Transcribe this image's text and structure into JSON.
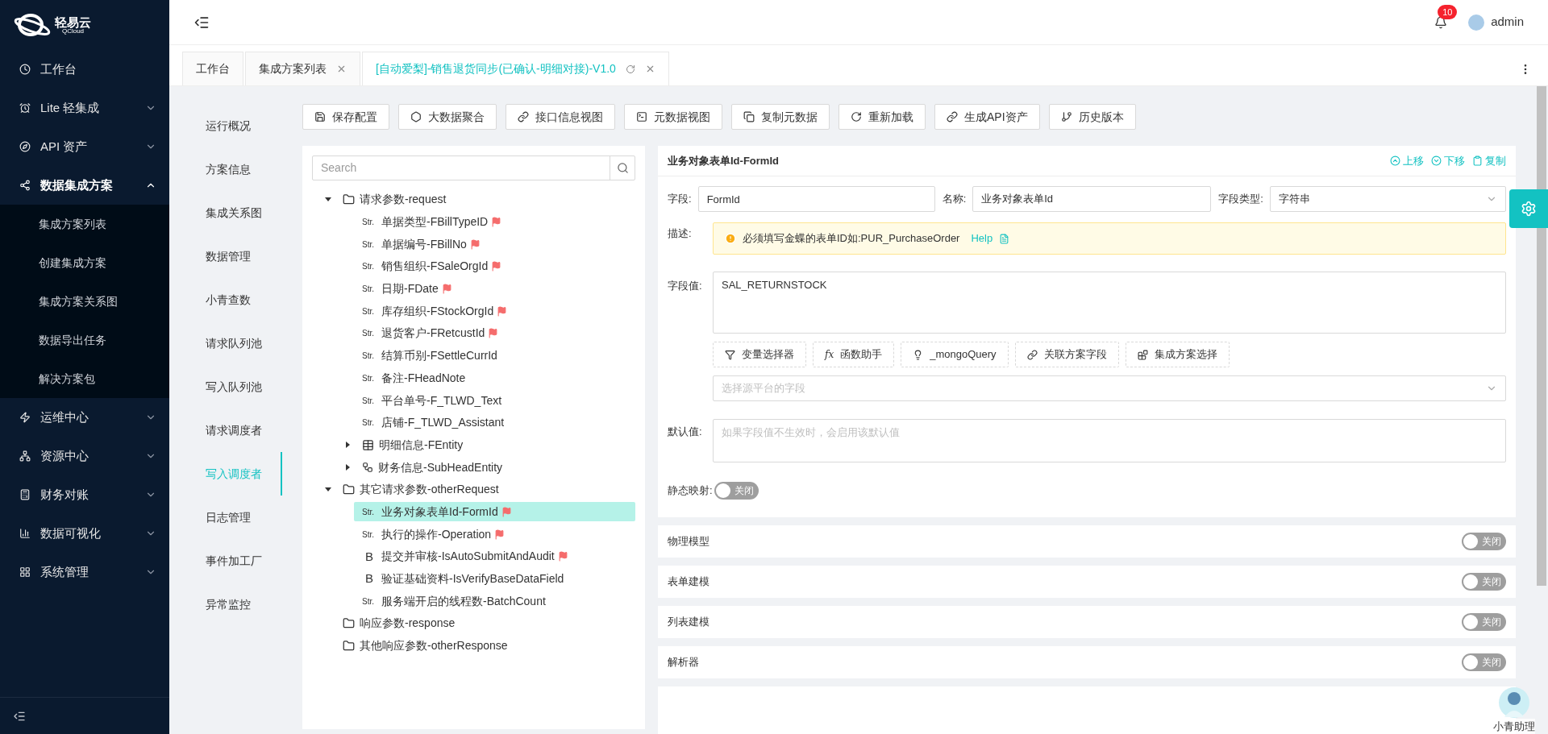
{
  "sidebar": {
    "logo": {
      "name": "轻易云",
      "sub": "QCloud"
    },
    "items": [
      {
        "label": "工作台",
        "kind": "clock"
      },
      {
        "label": "Lite 轻集成",
        "kind": "alarm",
        "expanded": false
      },
      {
        "label": "API 资产",
        "kind": "compass",
        "expanded": false
      },
      {
        "label": "数据集成方案",
        "kind": "graph",
        "expanded": true,
        "children": [
          {
            "label": "集成方案列表"
          },
          {
            "label": "创建集成方案"
          },
          {
            "label": "集成方案关系图"
          },
          {
            "label": "数据导出任务"
          },
          {
            "label": "解决方案包"
          }
        ]
      },
      {
        "label": "运维中心",
        "kind": "zap",
        "expanded": false
      },
      {
        "label": "资源中心",
        "kind": "network",
        "expanded": false
      },
      {
        "label": "财务对账",
        "kind": "calc",
        "expanded": false
      },
      {
        "label": "数据可视化",
        "kind": "chart",
        "expanded": false
      },
      {
        "label": "系统管理",
        "kind": "grid",
        "expanded": false
      }
    ]
  },
  "header": {
    "notifications": "10",
    "user": "admin"
  },
  "tabs": [
    {
      "label": "工作台",
      "selected": false,
      "closable": false,
      "refresh": false
    },
    {
      "label": "集成方案列表",
      "selected": false,
      "closable": true,
      "refresh": false
    },
    {
      "label": "[自动爱梨]-销售退货同步(已确认-明细对接)-V1.0",
      "selected": true,
      "closable": true,
      "refresh": true
    }
  ],
  "nav": [
    {
      "label": "运行概况",
      "selected": false
    },
    {
      "label": "方案信息",
      "selected": false
    },
    {
      "label": "集成关系图",
      "selected": false
    },
    {
      "label": "数据管理",
      "selected": false
    },
    {
      "label": "小青查数",
      "selected": false
    },
    {
      "label": "请求队列池",
      "selected": false
    },
    {
      "label": "写入队列池",
      "selected": false
    },
    {
      "label": "请求调度者",
      "selected": false
    },
    {
      "label": "写入调度者",
      "selected": true
    },
    {
      "label": "日志管理",
      "selected": false
    },
    {
      "label": "事件加工厂",
      "selected": false
    },
    {
      "label": "异常监控",
      "selected": false
    }
  ],
  "toolbar": [
    {
      "label": "保存配置",
      "kind": "save"
    },
    {
      "label": "大数据聚合",
      "kind": "hex"
    },
    {
      "label": "接口信息视图",
      "kind": "link"
    },
    {
      "label": "元数据视图",
      "kind": "terminal"
    },
    {
      "label": "复制元数据",
      "kind": "copy"
    },
    {
      "label": "重新加载",
      "kind": "reload"
    },
    {
      "label": "生成API资产",
      "kind": "link"
    },
    {
      "label": "历史版本",
      "kind": "branch"
    }
  ],
  "tree": {
    "search_placeholder": "Search",
    "nodes": [
      {
        "label": "请求参数-request",
        "kind": "folder",
        "expanded": true,
        "selected": false,
        "flag": false,
        "children": [
          {
            "label": "单据类型-FBillTypeID",
            "kind": "str",
            "type_label": "Str.",
            "selected": false,
            "flag": true
          },
          {
            "label": "单据编号-FBillNo",
            "kind": "str",
            "type_label": "Str.",
            "selected": false,
            "flag": true
          },
          {
            "label": "销售组织-FSaleOrgId",
            "kind": "str",
            "type_label": "Str.",
            "selected": false,
            "flag": true
          },
          {
            "label": "日期-FDate",
            "kind": "str",
            "type_label": "Str.",
            "selected": false,
            "flag": true
          },
          {
            "label": "库存组织-FStockOrgId",
            "kind": "str",
            "type_label": "Str.",
            "selected": false,
            "flag": true
          },
          {
            "label": "退货客户-FRetcustId",
            "kind": "str",
            "type_label": "Str.",
            "selected": false,
            "flag": true
          },
          {
            "label": "结算币别-FSettleCurrId",
            "kind": "str",
            "type_label": "Str.",
            "selected": false,
            "flag": false
          },
          {
            "label": "备注-FHeadNote",
            "kind": "str",
            "type_label": "Str.",
            "selected": false,
            "flag": false
          },
          {
            "label": "平台单号-F_TLWD_Text",
            "kind": "str",
            "type_label": "Str.",
            "selected": false,
            "flag": false
          },
          {
            "label": "店铺-F_TLWD_Assistant",
            "kind": "str",
            "type_label": "Str.",
            "selected": false,
            "flag": false
          },
          {
            "label": "明细信息-FEntity",
            "kind": "table",
            "expanded": false,
            "selected": false,
            "flag": false
          },
          {
            "label": "财务信息-SubHeadEntity",
            "kind": "graph",
            "expanded": false,
            "selected": false,
            "flag": false
          }
        ]
      },
      {
        "label": "其它请求参数-otherRequest",
        "kind": "folder",
        "expanded": true,
        "selected": false,
        "flag": false,
        "children": [
          {
            "label": "业务对象表单Id-FormId",
            "kind": "str",
            "type_label": "Str.",
            "selected": true,
            "flag": true
          },
          {
            "label": "执行的操作-Operation",
            "kind": "str",
            "type_label": "Str.",
            "selected": false,
            "flag": true
          },
          {
            "label": "提交并审核-IsAutoSubmitAndAudit",
            "kind": "bool",
            "type_label": "B",
            "selected": false,
            "flag": true
          },
          {
            "label": "验证基础资料-IsVerifyBaseDataField",
            "kind": "bool",
            "type_label": "B",
            "selected": false,
            "flag": false
          },
          {
            "label": "服务端开启的线程数-BatchCount",
            "kind": "str",
            "type_label": "Str.",
            "selected": false,
            "flag": false
          }
        ]
      },
      {
        "label": "响应参数-response",
        "kind": "folder",
        "selected": false,
        "flag": false
      },
      {
        "label": "其他响应参数-otherResponse",
        "kind": "folder",
        "selected": false,
        "flag": false
      }
    ]
  },
  "detail": {
    "title": "业务对象表单Id-FormId",
    "actions": [
      {
        "label": "上移",
        "kind": "up"
      },
      {
        "label": "下移",
        "kind": "down"
      },
      {
        "label": "复制",
        "kind": "copy"
      }
    ],
    "field": {
      "label": "字段:",
      "value": "FormId"
    },
    "name": {
      "label": "名称:",
      "value": "业务对象表单Id"
    },
    "type": {
      "label": "字段类型:",
      "value": "字符串"
    },
    "description": {
      "label": "描述:",
      "text": "必须填写金蝶的表单ID如:PUR_PurchaseOrder",
      "link": "Help"
    },
    "value": {
      "label": "字段值:",
      "value": "SAL_RETURNSTOCK"
    },
    "helpers": [
      {
        "label": "变量选择器",
        "kind": "filter"
      },
      {
        "label": "函数助手",
        "kind": "symbol",
        "symbol": "fx"
      },
      {
        "label": "_mongoQuery",
        "kind": "bulb"
      },
      {
        "label": "关联方案字段",
        "kind": "link"
      },
      {
        "label": "集成方案选择",
        "kind": "blocks"
      }
    ],
    "source": {
      "placeholder": "选择源平台的字段"
    },
    "default": {
      "label": "默认值:",
      "placeholder": "如果字段值不生效时，会启用该默认值"
    },
    "static_mapping": {
      "label": "静态映射:",
      "on": false,
      "text": "关闭"
    }
  },
  "sections": [
    {
      "title": "物理模型",
      "on": false,
      "text": "关闭"
    },
    {
      "title": "表单建模",
      "on": false,
      "text": "关闭"
    },
    {
      "title": "列表建模",
      "on": false,
      "text": "关闭"
    },
    {
      "title": "解析器",
      "on": false,
      "text": "关闭"
    }
  ],
  "assistant": {
    "label": "小青助理"
  }
}
